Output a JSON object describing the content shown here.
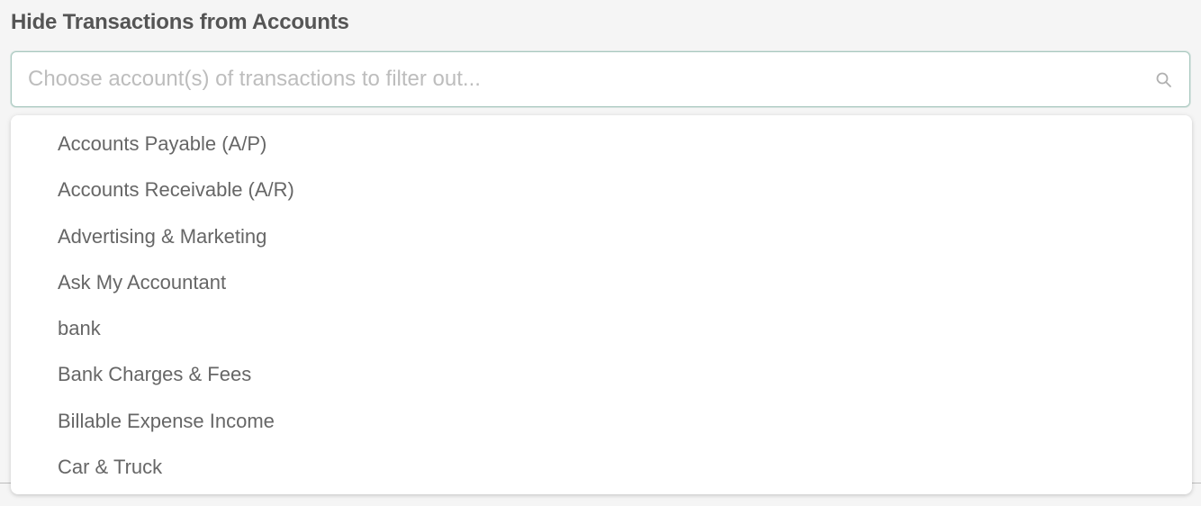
{
  "section": {
    "title": "Hide Transactions from Accounts"
  },
  "search": {
    "placeholder": "Choose account(s) of transactions to filter out...",
    "value": "",
    "icon": "search-icon"
  },
  "dropdown": {
    "options": [
      {
        "label": "Accounts Payable (A/P)"
      },
      {
        "label": "Accounts Receivable (A/R)"
      },
      {
        "label": "Advertising & Marketing"
      },
      {
        "label": "Ask My Accountant"
      },
      {
        "label": "bank"
      },
      {
        "label": "Bank Charges & Fees"
      },
      {
        "label": "Billable Expense Income"
      },
      {
        "label": "Car & Truck"
      }
    ]
  },
  "colors": {
    "title_text": "#555555",
    "option_text": "#666666",
    "placeholder_text": "#bdbdbd",
    "input_border": "#a9c8bf",
    "background": "#f5f5f5"
  }
}
